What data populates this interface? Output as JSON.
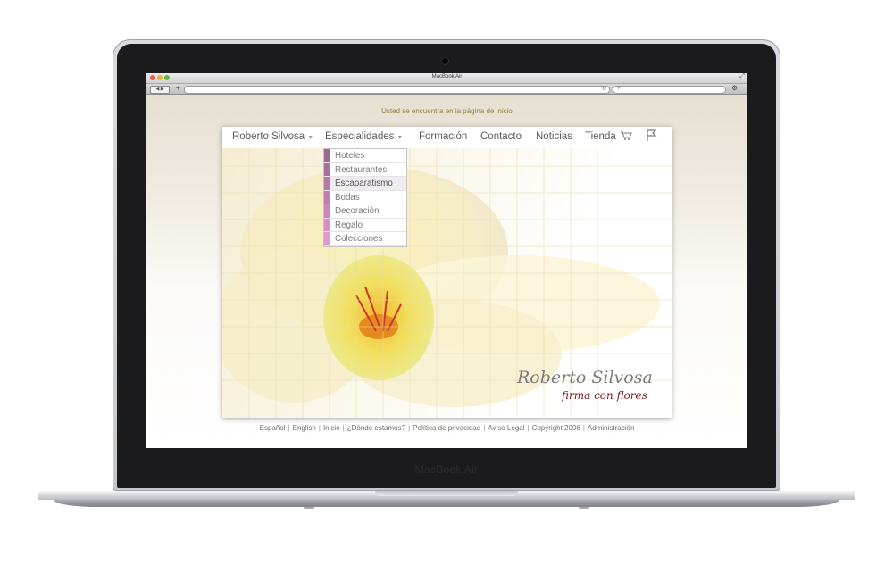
{
  "window": {
    "title": "MacBook Air"
  },
  "device": {
    "brand_prefix": "MacBook",
    "brand_suffix": "Air"
  },
  "page": {
    "location_text": "Usted se encuentra en la página de inicio"
  },
  "nav": {
    "items": [
      "Roberto Silvosa",
      "Especialidades",
      "Formación",
      "Contacto",
      "Noticias",
      "Tienda"
    ]
  },
  "dropdown": {
    "items": [
      "Hoteles",
      "Restaurantes",
      "Escaparatismo",
      "Bodas",
      "Decoración",
      "Regalo",
      "Colecciones"
    ],
    "selected": "Escaparatismo",
    "swatch_colors": [
      "#9b6a92",
      "#a8709e",
      "#b37aa8",
      "#c07fb4",
      "#cc86bf",
      "#d68ec8",
      "#df98d0"
    ]
  },
  "hero": {
    "title": "Roberto Silvosa",
    "subtitle": "firma con flores"
  },
  "footer": {
    "links": [
      "Español",
      "English",
      "Inicio",
      "¿Dónde estamos?",
      "Política de privacidad",
      "Aviso Legal",
      "Copyright 2006",
      "Administración"
    ]
  },
  "colors": {
    "location_text": "#9a7c3c",
    "subtitle": "#7a1a18",
    "flower": "#f2e67a"
  }
}
